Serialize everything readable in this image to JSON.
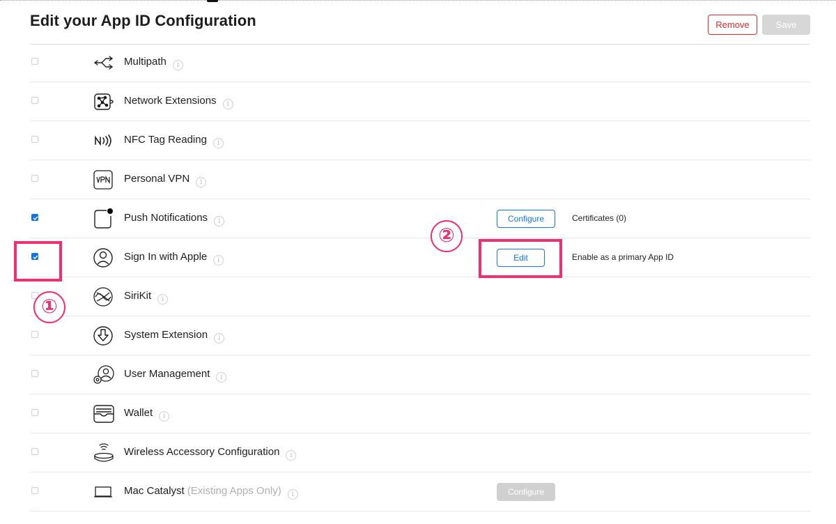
{
  "header": {
    "title": "Edit your App ID Configuration",
    "remove_label": "Remove",
    "save_label": "Save"
  },
  "rows": [
    {
      "label": "Multipath",
      "icon": "multipath-icon",
      "checked": false
    },
    {
      "label": "Network Extensions",
      "icon": "network-extensions-icon",
      "checked": false
    },
    {
      "label": "NFC Tag Reading",
      "icon": "nfc-icon",
      "checked": false
    },
    {
      "label": "Personal VPN",
      "icon": "vpn-icon",
      "checked": false
    },
    {
      "label": "Push Notifications",
      "icon": "push-notifications-icon",
      "checked": true,
      "button": "Configure",
      "note": "Certificates (0)"
    },
    {
      "label": "Sign In with Apple",
      "icon": "sign-in-with-apple-icon",
      "checked": true,
      "button": "Edit",
      "note": "Enable as a primary App ID"
    },
    {
      "label": "SiriKit",
      "icon": "sirikit-icon",
      "checked": false
    },
    {
      "label": "System Extension",
      "icon": "system-extension-icon",
      "checked": false
    },
    {
      "label": "User Management",
      "icon": "user-management-icon",
      "checked": false
    },
    {
      "label": "Wallet",
      "icon": "wallet-icon",
      "checked": false
    },
    {
      "label": "Wireless Accessory Configuration",
      "icon": "wireless-accessory-icon",
      "checked": false
    },
    {
      "label": "Mac Catalyst",
      "suffix": "(Existing Apps Only)",
      "icon": "mac-catalyst-icon",
      "checked": false,
      "button": "Configure",
      "button_disabled": true
    }
  ],
  "info_glyph": "i",
  "annotations": {
    "marker_1": "①",
    "marker_2": "②",
    "color": "#ef2f6e"
  },
  "colors": {
    "accent": "#1473e6",
    "remove": "#e8262e"
  }
}
